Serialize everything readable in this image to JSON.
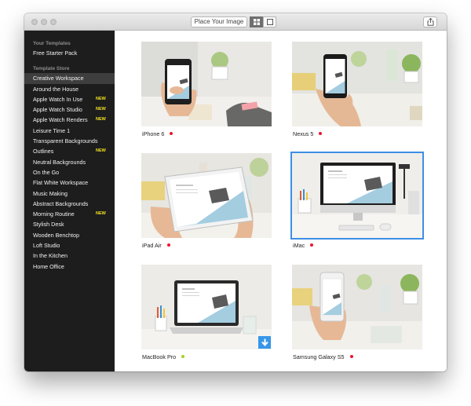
{
  "toolbar": {
    "place_label": "Place Your Image",
    "grid_view_icon": "grid-icon",
    "single_view_icon": "square-icon",
    "share_icon": "share-icon"
  },
  "sidebar": {
    "your_templates_heading": "Your Templates",
    "your_templates": [
      {
        "label": "Free Starter Pack",
        "badge": ""
      }
    ],
    "store_heading": "Template Store",
    "store_items": [
      {
        "label": "Creative Workspace",
        "badge": "",
        "selected": true
      },
      {
        "label": "Around the House",
        "badge": ""
      },
      {
        "label": "Apple Watch In Use",
        "badge": "NEW"
      },
      {
        "label": "Apple Watch Studio",
        "badge": "NEW"
      },
      {
        "label": "Apple Watch Renders",
        "badge": "NEW"
      },
      {
        "label": "Leisure Time 1",
        "badge": ""
      },
      {
        "label": "Transparent Backgrounds",
        "badge": ""
      },
      {
        "label": "Outlines",
        "badge": "NEW"
      },
      {
        "label": "Neutral Backgrounds",
        "badge": ""
      },
      {
        "label": "On the Go",
        "badge": ""
      },
      {
        "label": "Flat White Workspace",
        "badge": ""
      },
      {
        "label": "Music Making",
        "badge": ""
      },
      {
        "label": "Abstract Backgrounds",
        "badge": ""
      },
      {
        "label": "Morning Routine",
        "badge": "NEW"
      },
      {
        "label": "Stylish Desk",
        "badge": ""
      },
      {
        "label": "Wooden Benchtop",
        "badge": ""
      },
      {
        "label": "Loft Studio",
        "badge": ""
      },
      {
        "label": "In the Kitchen",
        "badge": ""
      },
      {
        "label": "Home Office",
        "badge": ""
      }
    ]
  },
  "templates": [
    {
      "name": "iPhone 6",
      "status_color": "#e8182e"
    },
    {
      "name": "Nexus 5",
      "status_color": "#e8182e"
    },
    {
      "name": "iPad Air",
      "status_color": "#e8182e"
    },
    {
      "name": "iMac",
      "status_color": "#e8182e",
      "selected": true
    },
    {
      "name": "MacBook Pro",
      "status_color": "#a8d021",
      "download_icon": "download-arrow-icon"
    },
    {
      "name": "Samsung Galaxy S5",
      "status_color": "#e8182e"
    }
  ],
  "colors": {
    "accent": "#3d8fe5",
    "badge_new": "#f0e020",
    "sidebar_bg": "#1d1d1d"
  }
}
